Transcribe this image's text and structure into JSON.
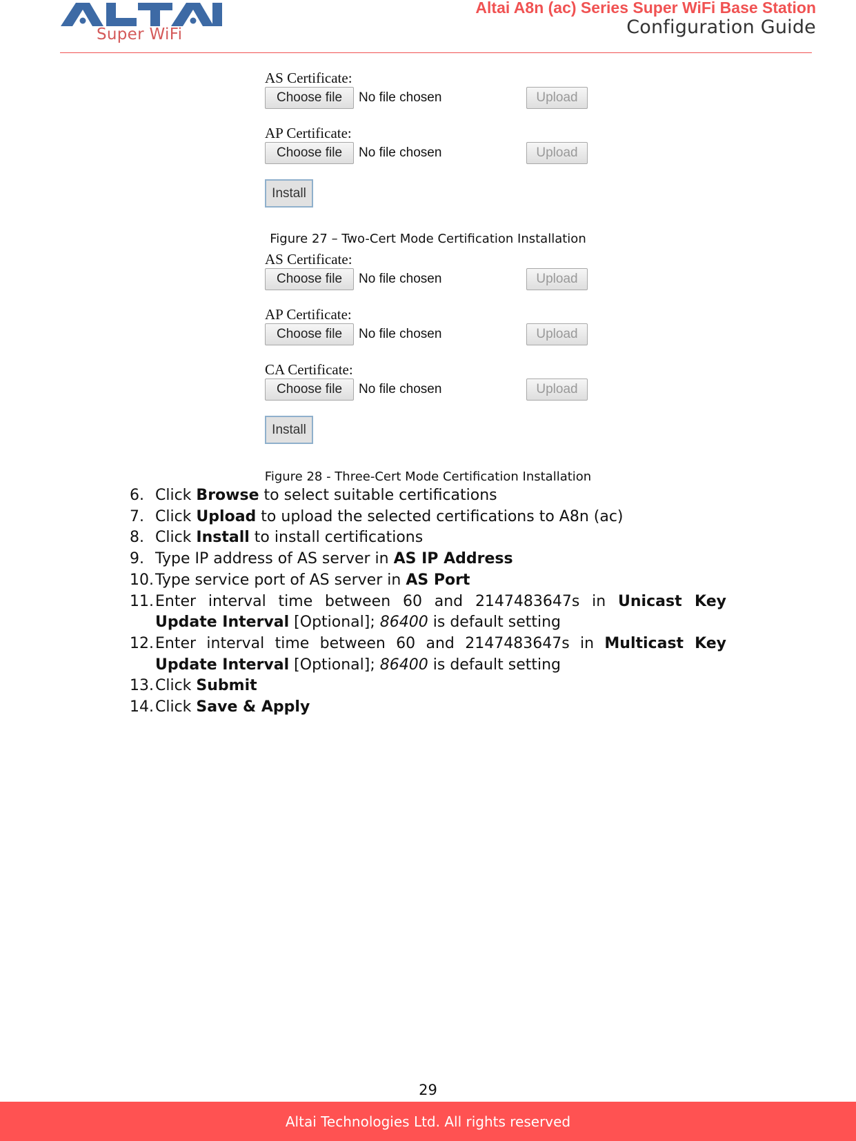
{
  "header": {
    "logo_text": "ALTAI",
    "logo_subtext": "Super WiFi",
    "doc_title": "Altai A8n (ac) Series Super WiFi Base Station",
    "doc_subtitle": "Configuration Guide",
    "colors": {
      "brand_red": "#f05252",
      "logo_blue": "#3d6aa5",
      "footer_red": "#ff5252"
    }
  },
  "figure27": {
    "caption": "Figure 27 – Two-Cert Mode Certification Installation",
    "certs": [
      {
        "label": "AS Certificate:",
        "choose_label": "Choose file",
        "file_status": "No file chosen",
        "upload_label": "Upload"
      },
      {
        "label": "AP Certificate:",
        "choose_label": "Choose file",
        "file_status": "No file chosen",
        "upload_label": "Upload"
      }
    ],
    "install_label": "Install"
  },
  "figure28": {
    "caption": "Figure 28 - Three-Cert Mode Certification Installation",
    "certs": [
      {
        "label": "AS Certificate:",
        "choose_label": "Choose file",
        "file_status": "No file chosen",
        "upload_label": "Upload"
      },
      {
        "label": "AP Certificate:",
        "choose_label": "Choose file",
        "file_status": "No file chosen",
        "upload_label": "Upload"
      },
      {
        "label": "CA Certificate:",
        "choose_label": "Choose file",
        "file_status": "No file chosen",
        "upload_label": "Upload"
      }
    ],
    "install_label": "Install"
  },
  "steps": [
    {
      "num": "6.",
      "parts": [
        {
          "t": "Click "
        },
        {
          "t": "Browse",
          "b": true
        },
        {
          "t": " to select suitable certifications"
        }
      ]
    },
    {
      "num": "7.",
      "parts": [
        {
          "t": "Click "
        },
        {
          "t": "Upload",
          "b": true
        },
        {
          "t": " to upload the selected certifications to A8n (ac)"
        }
      ]
    },
    {
      "num": "8.",
      "parts": [
        {
          "t": "Click "
        },
        {
          "t": "Install",
          "b": true
        },
        {
          "t": " to install certifications"
        }
      ]
    },
    {
      "num": "9.",
      "parts": [
        {
          "t": "Type IP address of AS server in "
        },
        {
          "t": "AS IP Address",
          "b": true
        }
      ]
    },
    {
      "num": "10.",
      "parts": [
        {
          "t": "Type service port of AS server in "
        },
        {
          "t": "AS Port",
          "b": true
        }
      ]
    },
    {
      "num": "11.",
      "parts": [
        {
          "t": "Enter interval time between 60 and 2147483647s in "
        },
        {
          "t": "Unicast Key Update Interval",
          "b": true
        },
        {
          "t": " [Optional]; "
        },
        {
          "t": "86400",
          "i": true
        },
        {
          "t": " is default setting"
        }
      ]
    },
    {
      "num": "12.",
      "parts": [
        {
          "t": "Enter interval time between 60 and 2147483647s in "
        },
        {
          "t": "Multicast Key Update Interval",
          "b": true
        },
        {
          "t": " [Optional]; "
        },
        {
          "t": "86400",
          "i": true
        },
        {
          "t": " is default setting"
        }
      ]
    },
    {
      "num": "13.",
      "parts": [
        {
          "t": "Click "
        },
        {
          "t": "Submit",
          "b": true
        }
      ]
    },
    {
      "num": "14.",
      "parts": [
        {
          "t": "Click "
        },
        {
          "t": "Save & Apply",
          "b": true
        }
      ]
    }
  ],
  "footer": {
    "page_number": "29",
    "copyright": "Altai Technologies Ltd. All rights reserved"
  }
}
